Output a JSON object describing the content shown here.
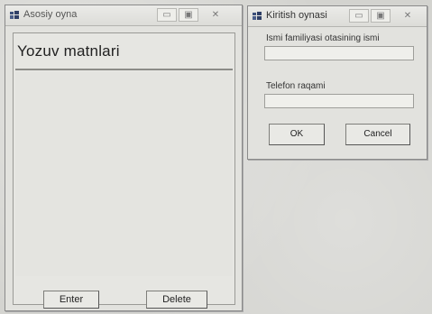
{
  "main_window": {
    "title": "Asosiy oyna",
    "heading": "Yozuv matnlari",
    "text_area_value": "",
    "enter_label": "Enter",
    "delete_label": "Delete",
    "minimize_glyph": "▭",
    "maximize_glyph": "▣",
    "close_glyph": "✕"
  },
  "dialog": {
    "title": "Kiritish oynasi",
    "name_label": "Ismi familiyasi otasining ismi",
    "name_value": "",
    "phone_label": "Telefon raqami",
    "phone_value": "",
    "ok_label": "OK",
    "cancel_label": "Cancel",
    "minimize_glyph": "▭",
    "maximize_glyph": "▣",
    "close_glyph": "✕"
  },
  "colors": {
    "window_bg": "#e2e2de",
    "page_bg": "#d3d3cf",
    "border": "#8a8a8a"
  },
  "icons": {
    "app_icon": "app-icon"
  }
}
